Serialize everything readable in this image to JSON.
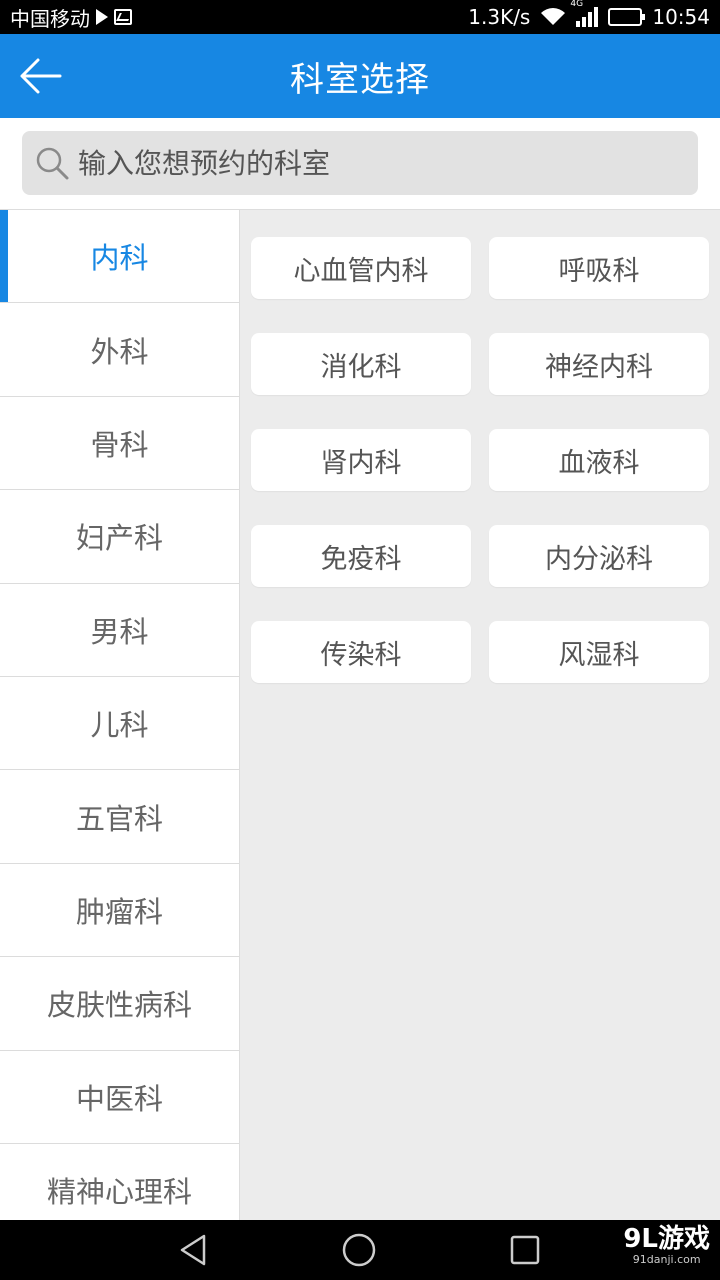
{
  "status_bar": {
    "carrier": "中国移动",
    "net_speed": "1.3K/s",
    "network_tag": "4G",
    "time": "10:54"
  },
  "header": {
    "title": "科室选择"
  },
  "search": {
    "placeholder": "输入您想预约的科室"
  },
  "sidebar": {
    "items": [
      {
        "label": "内科"
      },
      {
        "label": "外科"
      },
      {
        "label": "骨科"
      },
      {
        "label": "妇产科"
      },
      {
        "label": "男科"
      },
      {
        "label": "儿科"
      },
      {
        "label": "五官科"
      },
      {
        "label": "肿瘤科"
      },
      {
        "label": "皮肤性病科"
      },
      {
        "label": "中医科"
      },
      {
        "label": "精神心理科"
      }
    ]
  },
  "departments": [
    {
      "label": "心血管内科"
    },
    {
      "label": "呼吸科"
    },
    {
      "label": "消化科"
    },
    {
      "label": "神经内科"
    },
    {
      "label": "肾内科"
    },
    {
      "label": "血液科"
    },
    {
      "label": "免疫科"
    },
    {
      "label": "内分泌科"
    },
    {
      "label": "传染科"
    },
    {
      "label": "风湿科"
    }
  ],
  "watermark": {
    "logo": "9L游戏",
    "url": "91danji.com"
  },
  "colors": {
    "accent": "#1787e3",
    "background": "#ececec"
  }
}
